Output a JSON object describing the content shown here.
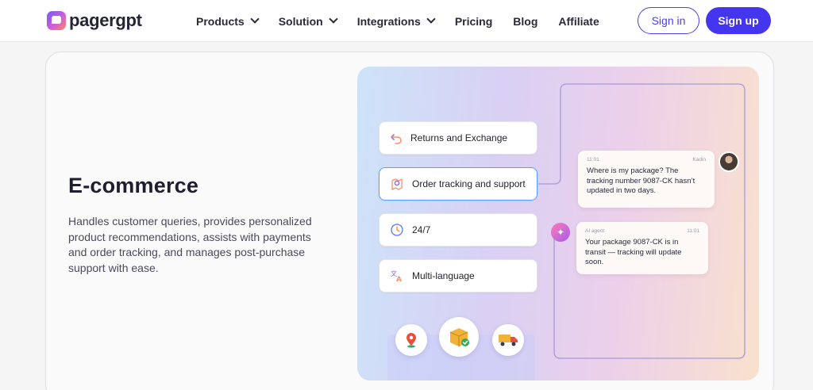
{
  "brand": {
    "name": "pagergpt"
  },
  "nav": {
    "items": [
      {
        "label": "Products",
        "dropdown": true
      },
      {
        "label": "Solution",
        "dropdown": true
      },
      {
        "label": "Integrations",
        "dropdown": true
      },
      {
        "label": "Pricing",
        "dropdown": false
      },
      {
        "label": "Blog",
        "dropdown": false
      },
      {
        "label": "Affiliate",
        "dropdown": false
      }
    ],
    "signin": "Sign in",
    "signup": "Sign up"
  },
  "section": {
    "title": "E-commerce",
    "description": "Handles customer queries, provides personalized product recommendations, assists with payments and order tracking, and manages post-purchase support with ease."
  },
  "features": [
    {
      "label": "Returns and Exchange",
      "icon": "return-arrow-icon"
    },
    {
      "label": "Order tracking and support",
      "icon": "map-pin-icon"
    },
    {
      "label": "24/7",
      "icon": "clock-icon"
    },
    {
      "label": "Multi-language",
      "icon": "translate-icon"
    }
  ],
  "chat": {
    "user": {
      "time": "11:01",
      "name": "Kadin",
      "text": "Where is my package? The tracking number 9087-CK hasn’t updated in two days."
    },
    "agent": {
      "name": "AI agent",
      "time": "11:01",
      "text": "Your package 9087-CK is in transit — tracking will update soon."
    }
  },
  "bottom_icons": [
    "location-pin-icon",
    "package-check-icon",
    "delivery-truck-icon"
  ],
  "colors": {
    "accent": "#4436ee",
    "active_border": "#4ea3ff"
  }
}
